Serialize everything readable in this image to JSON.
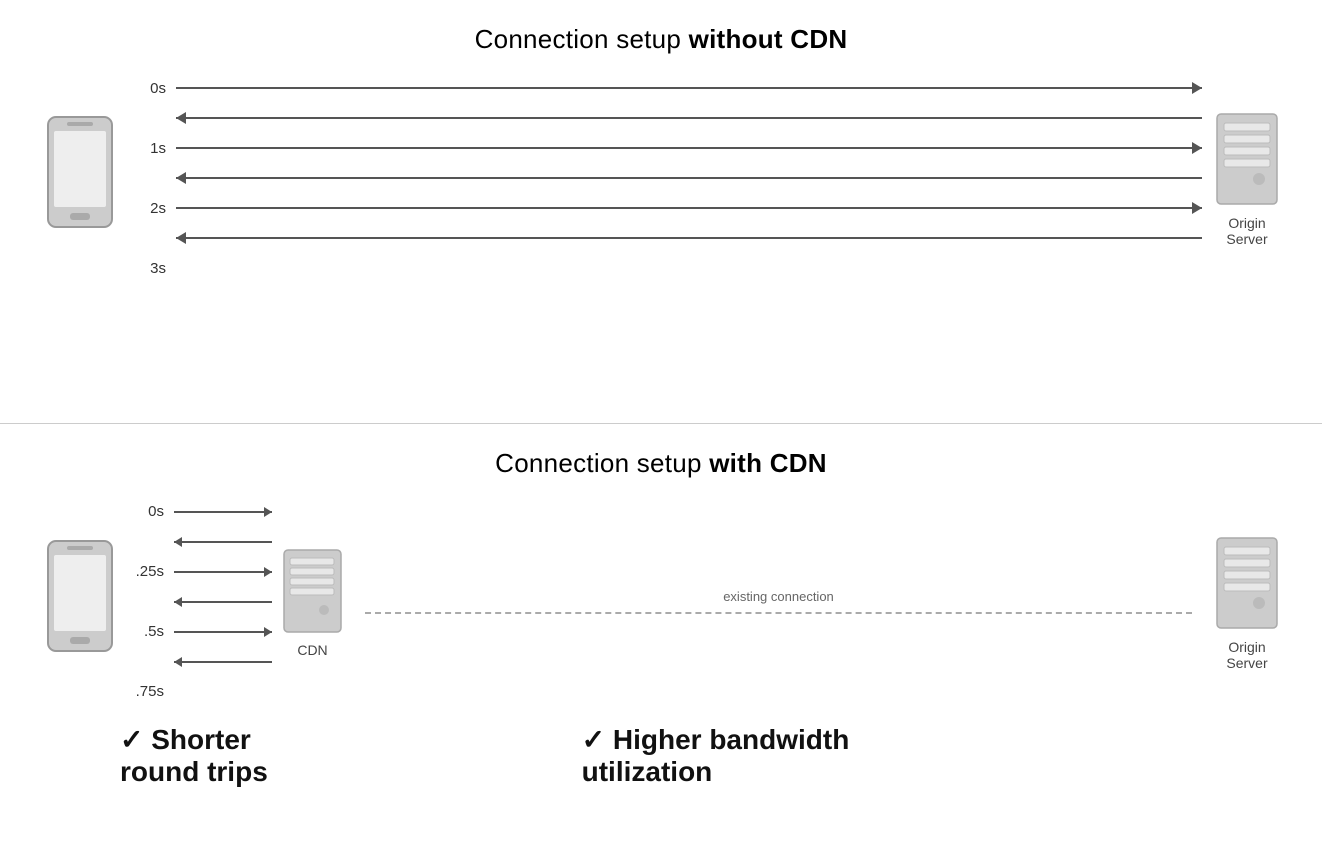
{
  "top_section": {
    "title_normal": "Connection setup ",
    "title_bold": "without CDN",
    "time_labels": [
      "0s",
      "1s",
      "2s",
      "3s"
    ],
    "server_label": "Origin\nServer"
  },
  "bottom_section": {
    "title_normal": "Connection setup ",
    "title_bold": "with CDN",
    "time_labels": [
      "0s",
      ".25s",
      ".5s",
      ".75s"
    ],
    "cdn_label": "CDN",
    "existing_label": "existing connection",
    "server_label": "Origin\nServer"
  },
  "callouts": {
    "left_check": "✓",
    "left_text": "Shorter\nround trips",
    "right_check": "✓",
    "right_text": "Higher bandwidth\nutilization"
  }
}
